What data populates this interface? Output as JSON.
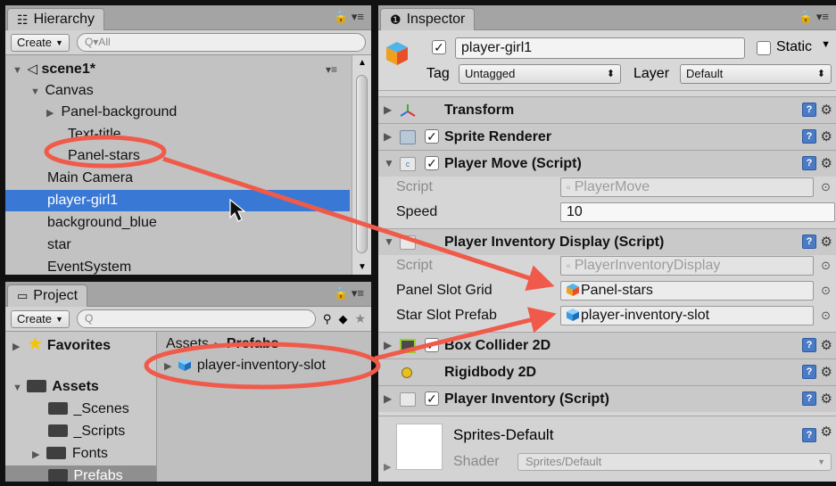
{
  "hierarchy": {
    "tab_label": "Hierarchy",
    "create_label": "Create",
    "search_placeholder": "Q▾All",
    "scene": "scene1*",
    "items": [
      {
        "label": "Canvas"
      },
      {
        "label": "Panel-background"
      },
      {
        "label": "Text-title"
      },
      {
        "label": "Panel-stars"
      },
      {
        "label": "Main Camera"
      },
      {
        "label": "player-girl1"
      },
      {
        "label": "background_blue"
      },
      {
        "label": "star"
      },
      {
        "label": "EventSystem"
      }
    ],
    "selected": "player-girl1"
  },
  "project": {
    "tab_label": "Project",
    "create_label": "Create",
    "search_placeholder": "Q",
    "tree": [
      {
        "label": "Favorites"
      },
      {
        "label": "Assets"
      },
      {
        "label": "_Scenes"
      },
      {
        "label": "_Scripts"
      },
      {
        "label": "Fonts"
      },
      {
        "label": "Prefabs"
      }
    ],
    "breadcrumb_root": "Assets",
    "breadcrumb_sep": "►",
    "breadcrumb_current": "Prefabs",
    "asset": "player-inventory-slot"
  },
  "inspector": {
    "tab_label": "Inspector",
    "object_name": "player-girl1",
    "static_label": "Static",
    "tag_label": "Tag",
    "tag_value": "Untagged",
    "layer_label": "Layer",
    "layer_value": "Default",
    "components": [
      {
        "name": "Transform"
      },
      {
        "name": "Sprite Renderer"
      },
      {
        "name": "Player Move (Script)"
      },
      {
        "name": "Player Inventory Display (Script)"
      },
      {
        "name": "Box Collider 2D"
      },
      {
        "name": "Rigidbody 2D"
      },
      {
        "name": "Player Inventory (Script)"
      }
    ],
    "player_move": {
      "script_label": "Script",
      "script_value": "PlayerMove",
      "speed_label": "Speed",
      "speed_value": "10"
    },
    "inventory_display": {
      "script_label": "Script",
      "script_value": "PlayerInventoryDisplay",
      "panel_label": "Panel Slot Grid",
      "panel_value": "Panel-stars",
      "prefab_label": "Star Slot Prefab",
      "prefab_value": "player-inventory-slot"
    },
    "material": {
      "name": "Sprites-Default",
      "shader_label": "Shader",
      "shader_value": "Sprites/Default"
    }
  },
  "colors": {
    "selection": "#3a78d6",
    "annotation": "#f05a4a",
    "help_icon": "#4b7bc4"
  }
}
